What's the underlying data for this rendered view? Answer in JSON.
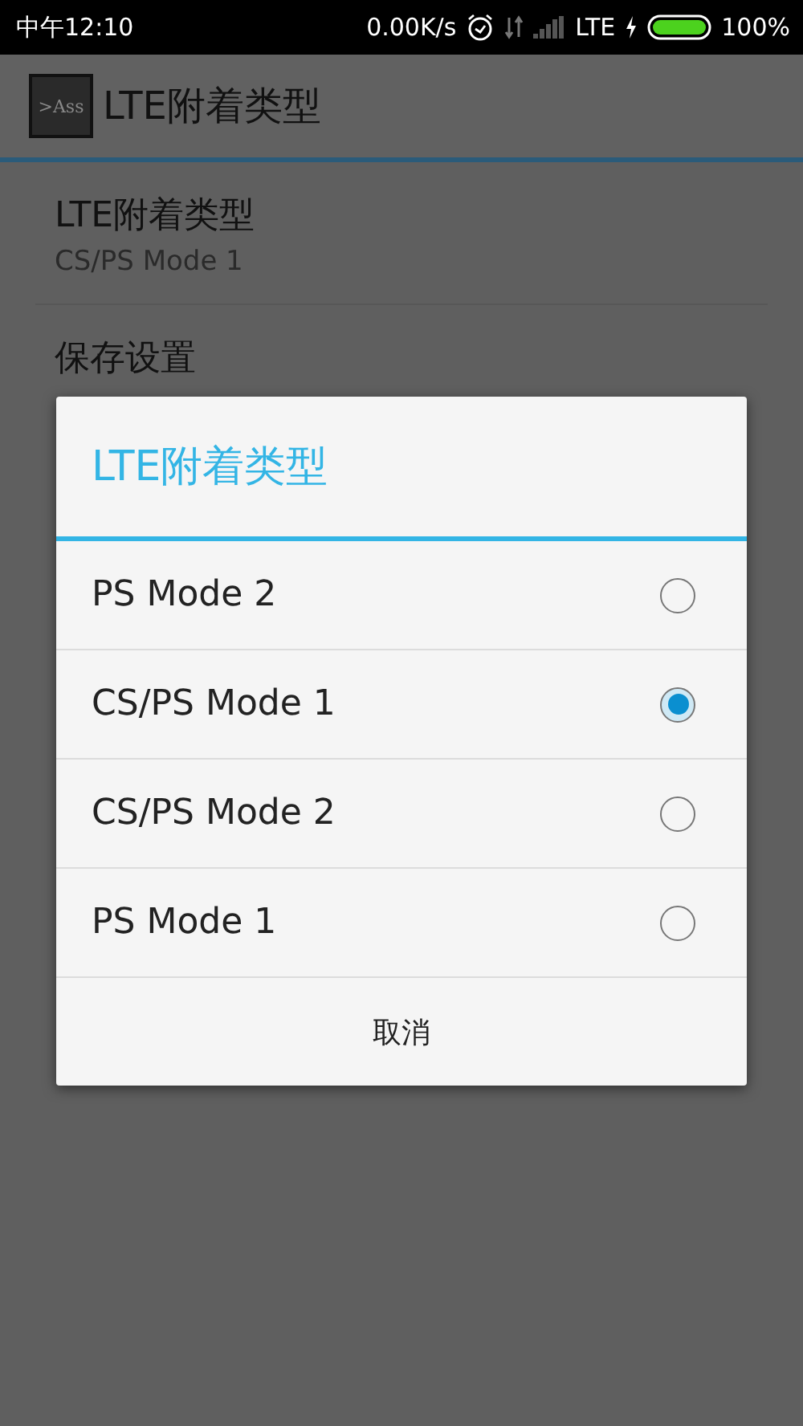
{
  "status_bar": {
    "time": "中午12:10",
    "speed": "0.00K/s",
    "network": "LTE",
    "battery": "100%"
  },
  "app_bar": {
    "icon_text": ">Ass",
    "title": "LTE附着类型"
  },
  "settings": [
    {
      "title": "LTE附着类型",
      "summary": "CS/PS Mode 1"
    },
    {
      "title": "保存设置"
    }
  ],
  "dialog": {
    "title": "LTE附着类型",
    "options": [
      {
        "label": "PS Mode 2",
        "selected": false
      },
      {
        "label": "CS/PS Mode 1",
        "selected": true
      },
      {
        "label": "CS/PS Mode 2",
        "selected": false
      },
      {
        "label": "PS Mode 1",
        "selected": false
      }
    ],
    "cancel": "取消"
  }
}
